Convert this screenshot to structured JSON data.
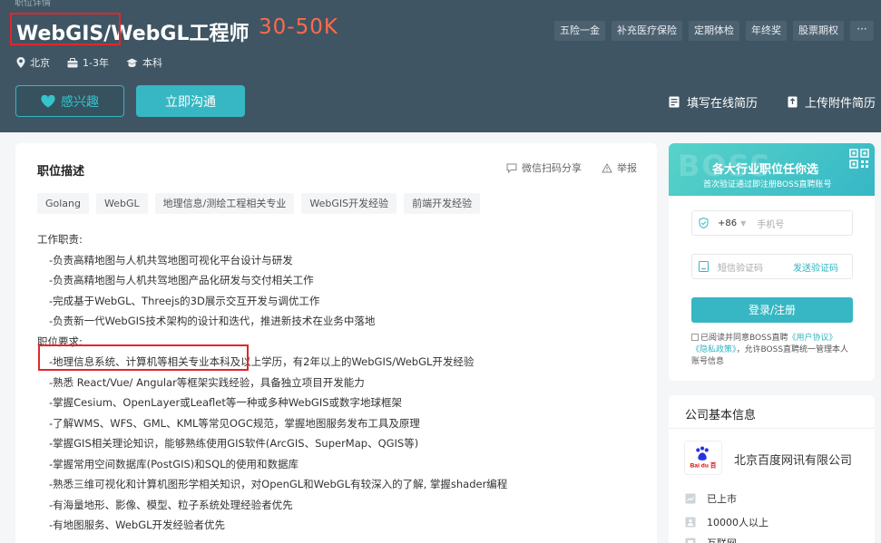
{
  "header": {
    "breadcrumb": "职位详情",
    "job_title": "WebGIS/WebGL工程师",
    "salary": "30-50K",
    "welfare": [
      "五险一金",
      "补充医疗保险",
      "定期体检",
      "年终奖",
      "股票期权"
    ],
    "welfare_more": "···",
    "city": "北京",
    "experience": "1-3年",
    "degree": "本科",
    "like_label": "感兴趣",
    "chat_label": "立即沟通",
    "fill_resume_label": "填写在线简历",
    "upload_resume_label": "上传附件简历"
  },
  "job": {
    "section_title": "职位描述",
    "share_label": "微信扫码分享",
    "report_label": "举报",
    "skills": [
      "Golang",
      "WebGL",
      "地理信息/测绘工程相关专业",
      "WebGIS开发经验",
      "前端开发经验"
    ],
    "duties_heading": "工作职责:",
    "duties": [
      "-负责高精地图与人机共驾地图可视化平台设计与研发",
      "-负责高精地图与人机共驾地图产品化研发与交付相关工作",
      "-完成基于WebGL、Threejs的3D展示交互开发与调优工作",
      "-负责新一代WebGIS技术架构的设计和迭代，推进新技术在业务中落地"
    ],
    "requirements_heading": "职位要求:",
    "requirements": [
      "-地理信息系统、计算机等相关专业本科及以上学历，有2年以上的WebGIS/WebGL开发经验",
      "-熟悉 React/Vue/ Angular等框架实践经验，具备独立项目开发能力",
      "-掌握Cesium、OpenLayer或Leaflet等一种或多种WebGIS或数字地球框架",
      "-了解WMS、WFS、GML、KML等常见OGC规范，掌握地图服务发布工具及原理",
      "-掌握GIS相关理论知识，能够熟练使用GIS软件(ArcGIS、SuperMap、QGIS等)",
      "-掌握常用空间数据库(PostGIS)和SQL的使用和数据库",
      "-熟悉三维可视化和计算机图形学相关知识，对OpenGL和WebGL有较深入的了解, 掌握shader编程",
      "-有海量地形、影像、模型、粒子系统处理经验者优先",
      "-有地图服务、WebGL开发经验者优先"
    ]
  },
  "login": {
    "watermark": "BOSS",
    "headline": "各大行业职位任你选",
    "subline": "首次验证通过即注册BOSS直聘账号",
    "country_code": "+86",
    "phone_placeholder": "手机号",
    "code_placeholder": "短信验证码",
    "send_code_label": "发送验证码",
    "submit_label": "登录/注册",
    "agree_prefix": "已阅读并同意BOSS直聘",
    "agree_link1": "《用户协议》",
    "agree_link2": "《隐私政策》",
    "agree_suffix": "，允许BOSS直聘统一管理本人账号信息"
  },
  "company": {
    "section_title": "公司基本信息",
    "name": "北京百度网讯有限公司",
    "logo_text": "Bai du 百",
    "stage": "已上市",
    "size": "10000人以上",
    "industry": "互联网"
  },
  "colors": {
    "header_bg": "#3f5563",
    "accent": "#37b7c3",
    "salary": "#ff6a4a",
    "highlight_box": "#e3262a"
  }
}
